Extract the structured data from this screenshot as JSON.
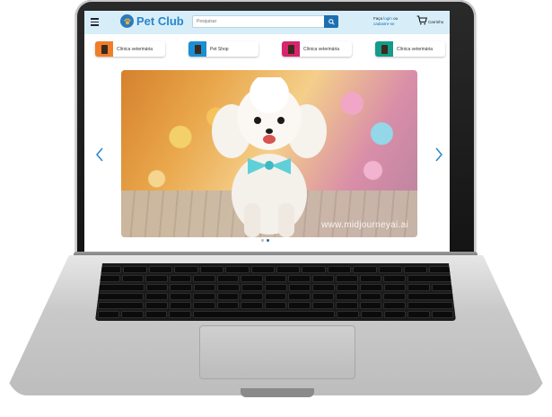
{
  "header": {
    "brand_name": "Pet Club",
    "search_placeholder": "Pesquisar",
    "login_line1": "Faça",
    "login_link": "login",
    "login_or": "ou",
    "login_line2": "cadastre-se",
    "cart_label": "Carrinho"
  },
  "services": [
    {
      "label": "Clínica veterinária",
      "color": "#ef7d2a",
      "icon": "vet-icon"
    },
    {
      "label": "Pet Shop",
      "color": "#1b8fd6",
      "icon": "shop-icon"
    },
    {
      "label": "Clínica veterinária",
      "color": "#d6246e",
      "icon": "vet-icon"
    },
    {
      "label": "Clínica veterinária",
      "color": "#169a8a",
      "icon": "vet-icon"
    }
  ],
  "carousel": {
    "watermark": "www.midjourneyai.ai",
    "slide_count": 2,
    "active_slide": 2
  },
  "colors": {
    "header_bg": "#d7eef9",
    "accent": "#1d6fb0",
    "brand": "#2a86c9"
  }
}
